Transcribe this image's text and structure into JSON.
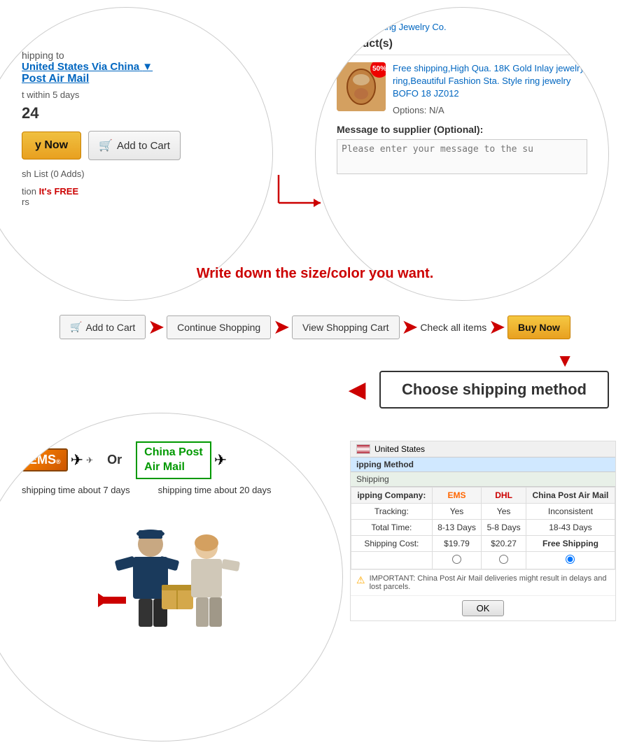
{
  "page": {
    "write_down_text": "Write down the size/color you want."
  },
  "left_circle": {
    "shipping_label": "hipping to",
    "shipping_link": "United States Via China",
    "post_air_mail": "Post Air Mail",
    "dropdown_icon": "▼",
    "within_days": "t within 5 days",
    "price": "24",
    "btn_buy_now": "y Now",
    "btn_add_cart": "Add to Cart",
    "wish_list": "sh List (0 Adds)",
    "protection_label": "tion",
    "protection_value": "It's FREE",
    "years_label": "rs"
  },
  "right_circle": {
    "seller_name": "ner: ZhuoYang Jewelry Co.",
    "products_header": "Product(s)",
    "product_title": "Free shipping,High Qua. 18K Gold Inlay jewelry ring,Beautiful Fashion Sta. Style ring jewelry BOFO 18 JZ012",
    "options": "Options:  N/A",
    "discount": "50%",
    "msg_label": "Message to supplier (Optional):",
    "msg_placeholder": "Please enter your message to the su"
  },
  "steps": {
    "add_to_cart": "Add to Cart",
    "continue_shopping": "Continue Shopping",
    "view_cart": "View Shopping Cart",
    "check_items": "Check all items",
    "buy_now": "Buy Now"
  },
  "shipping_method": {
    "label": "Choose shipping method"
  },
  "bottom_circle": {
    "or_text": "Or",
    "china_post_line1": "China Post",
    "china_post_line2": "Air Mail",
    "ems_time": "shipping time about 7 days",
    "china_post_time": "shipping time about 20 days"
  },
  "shipping_table": {
    "country": "United States",
    "section_label": "ipping Method",
    "section_label2": "Shipping",
    "col_company": "ipping Company:",
    "col_ems": "EMS",
    "col_dhl": "DHL",
    "col_china_post": "China Post Air Mail",
    "row_tracking": "Tracking:",
    "ems_tracking": "Yes",
    "dhl_tracking": "Yes",
    "china_tracking": "Inconsistent",
    "row_time": "Total Time:",
    "ems_time": "8-13 Days",
    "dhl_time": "5-8 Days",
    "china_time": "18-43 Days",
    "row_cost": "Shipping Cost:",
    "ems_cost": "$19.79",
    "dhl_cost": "$20.27",
    "china_cost": "Free Shipping",
    "important_text": "IMPORTANT: China Post Air Mail deliveries might result in delays and lost parcels.",
    "ok_btn": "OK"
  }
}
